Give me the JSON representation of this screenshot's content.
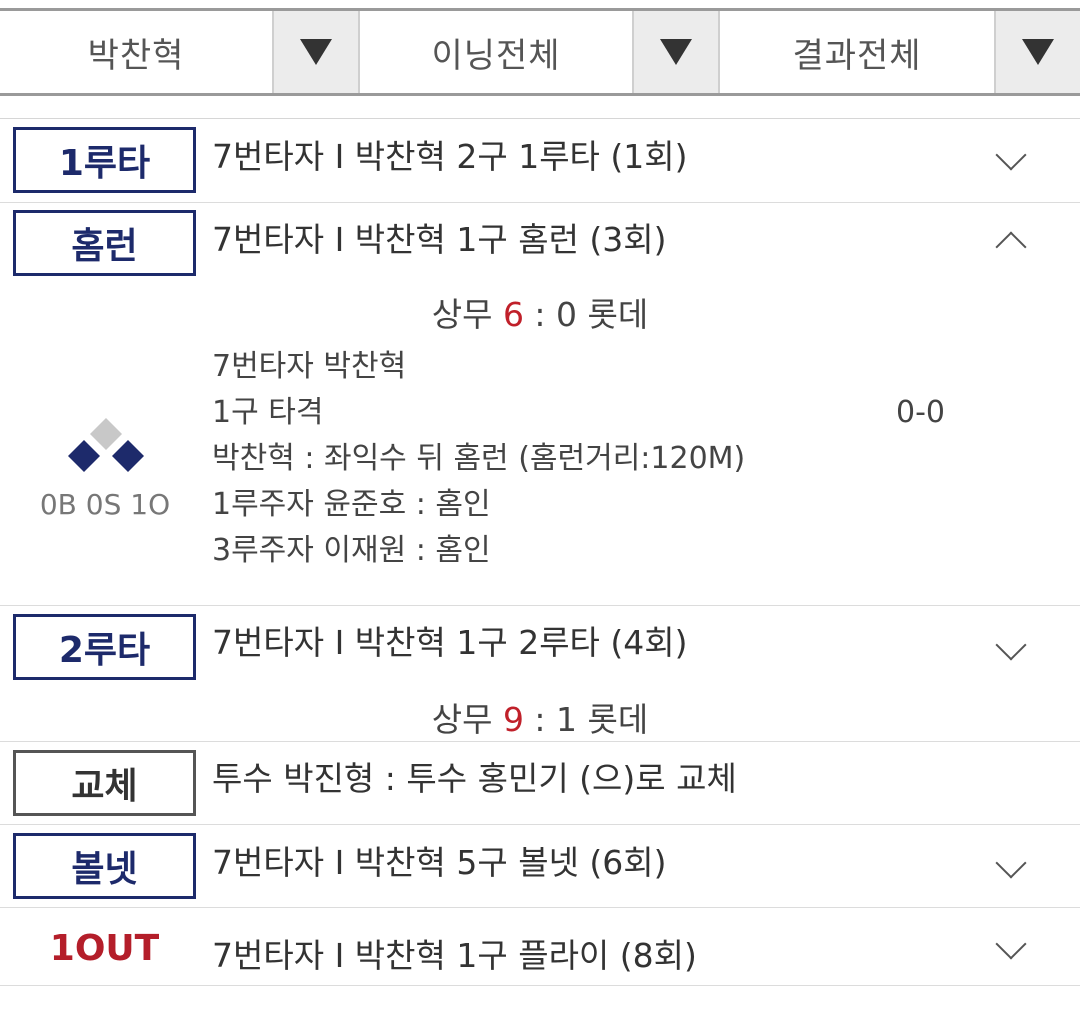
{
  "filters": [
    {
      "label": "박찬혁"
    },
    {
      "label": "이닝전체"
    },
    {
      "label": "결과전체"
    }
  ],
  "events": [
    {
      "badge": "1루타",
      "text": "7번타자 I 박찬혁 2구 1루타 (1회)"
    },
    {
      "badge": "홈런",
      "text": "7번타자 I 박찬혁 1구 홈런 (3회)"
    },
    {
      "badge": "2루타",
      "text": "7번타자 I 박찬혁 1구 2루타 (4회)"
    },
    {
      "badge": "교체",
      "text": "투수 박진형 : 투수 홍민기 (으)로 교체"
    },
    {
      "badge": "볼넷",
      "text": "7번타자 I 박찬혁 5구 볼넷 (6회)"
    },
    {
      "badge": "1OUT",
      "text": "7번타자 I 박찬혁 1구 플라이 (8회)"
    }
  ],
  "scores": [
    {
      "home": "상무",
      "home_score": "6",
      "sep": " : ",
      "away_score": "0",
      "away": "롯데"
    },
    {
      "home": "상무",
      "home_score": "9",
      "sep": " : ",
      "away_score": "1",
      "away": "롯데"
    }
  ],
  "homerun_detail": {
    "lines": [
      "7번타자 박찬혁",
      "1구 타격",
      "박찬혁 : 좌익수 뒤 홈런 (홈런거리:120M)",
      "1루주자 윤준호 : 홈인",
      "3루주자 이재원 : 홈인"
    ],
    "count": "0-0",
    "bso": "0B 0S 1O",
    "bases": {
      "first": "occupied",
      "second": "empty",
      "third": "occupied"
    }
  },
  "colors": {
    "navy": "#1d2a6b",
    "red": "#b41e2a",
    "score_highlight": "#c0202a",
    "base_empty": "#c8c8c8"
  },
  "icons": {
    "filter_arrow": "triangle-down-icon",
    "expand": "chevron-down-icon",
    "collapse": "chevron-up-icon"
  }
}
